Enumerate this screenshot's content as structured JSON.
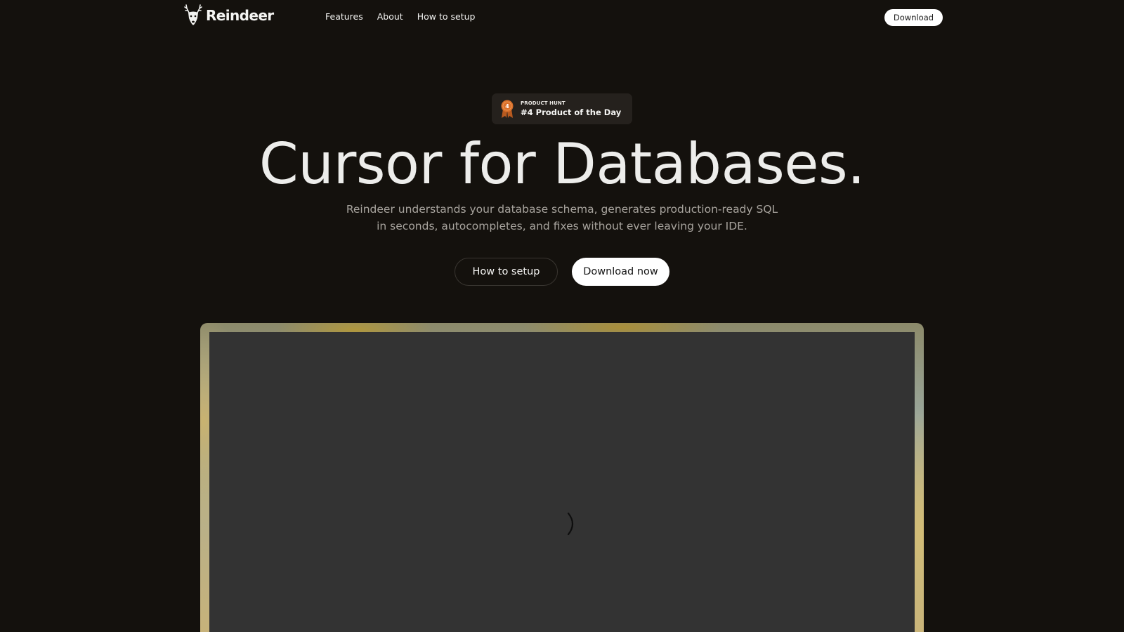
{
  "nav": {
    "brand": "Reindeer",
    "links": [
      "Features",
      "About",
      "How to setup"
    ],
    "download_label": "Download"
  },
  "badge": {
    "overline": "PRODUCT HUNT",
    "title": "#4 Product of the Day",
    "rank": "4"
  },
  "hero": {
    "title": "Cursor for Databases.",
    "subtitle": "Reindeer understands your database schema, generates production-ready SQL in seconds, autocompletes, and fixes without ever leaving your IDE.",
    "cta_secondary": "How to setup",
    "cta_primary": "Download now"
  },
  "colors": {
    "background": "#14110d",
    "badge_bg": "#25211d",
    "medal": "#d9702a",
    "screen": "#333333"
  },
  "icons": {
    "logo": "reindeer-head-icon",
    "badge": "medal-icon",
    "loader": "spinner-icon"
  }
}
